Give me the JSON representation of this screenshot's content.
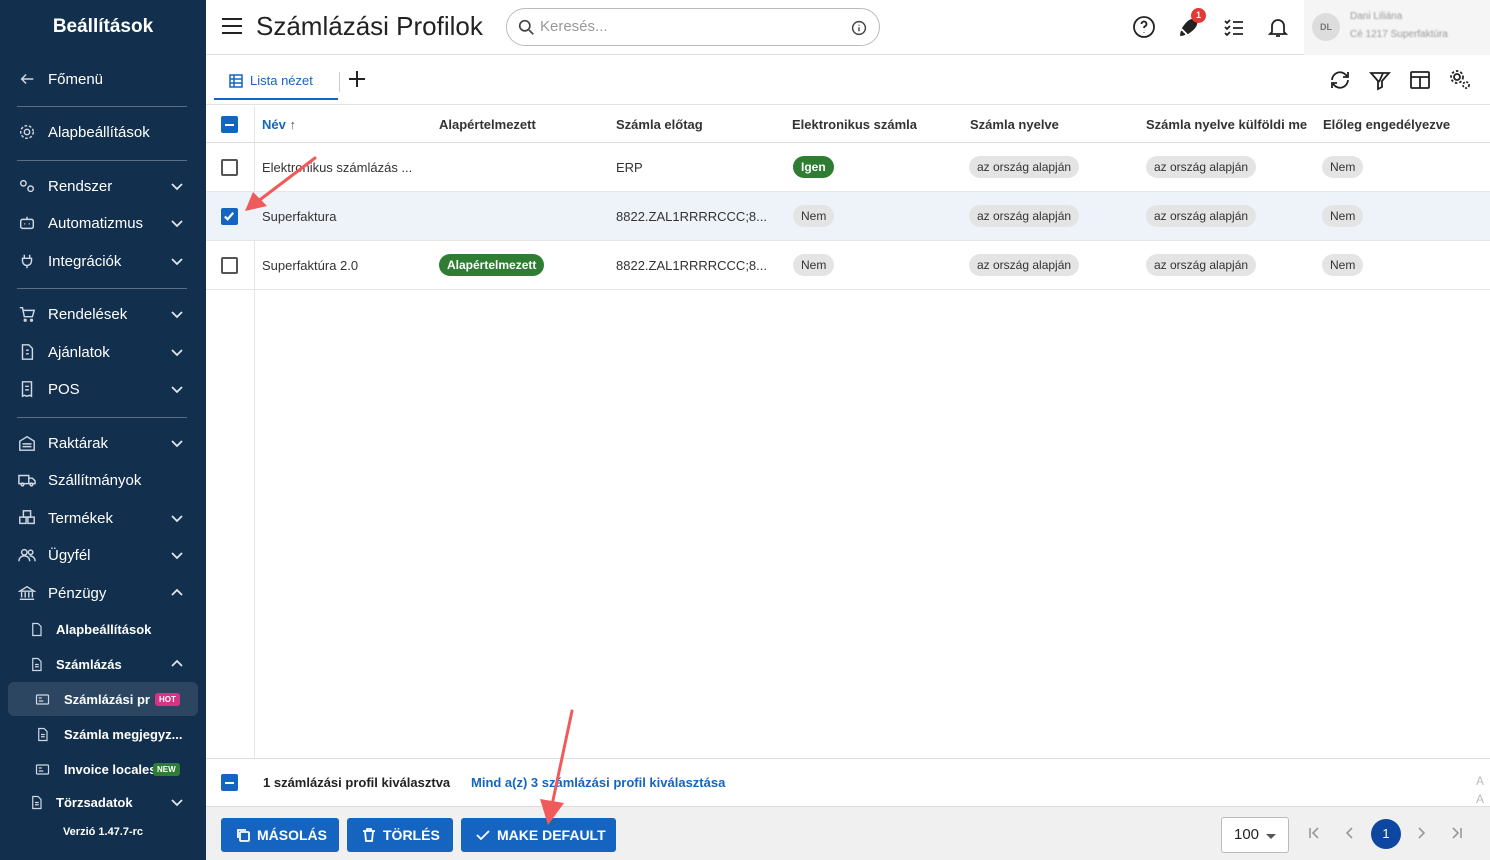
{
  "sidebar": {
    "title": "Beállítások",
    "items": [
      {
        "label": "Főmenü",
        "icon": "arrow-left-icon"
      },
      {
        "label": "Alapbeállítások",
        "icon": "gear-icon"
      },
      {
        "label": "Rendszer",
        "icon": "settings-icon"
      },
      {
        "label": "Automatizmus",
        "icon": "robot-icon"
      },
      {
        "label": "Integrációk",
        "icon": "plug-icon"
      },
      {
        "label": "Rendelések",
        "icon": "cart-icon"
      },
      {
        "label": "Ajánlatok",
        "icon": "document-icon"
      },
      {
        "label": "POS",
        "icon": "receipt-icon"
      },
      {
        "label": "Raktárak",
        "icon": "warehouse-icon"
      },
      {
        "label": "Szállítmányok",
        "icon": "truck-icon"
      },
      {
        "label": "Termékek",
        "icon": "box-icon"
      },
      {
        "label": "Ügyfél",
        "icon": "users-icon"
      },
      {
        "label": "Pénzügy",
        "icon": "bank-icon"
      }
    ],
    "sub": [
      {
        "label": "Alapbeállítások"
      },
      {
        "label": "Számlázás"
      },
      {
        "label": "Számlázási pr",
        "badge": "HOT"
      },
      {
        "label": "Számla megjegyz..."
      },
      {
        "label": "Invoice locales",
        "badge": "NEW"
      },
      {
        "label": "Törzsadatok"
      }
    ],
    "version": "Verzió 1.47.7-rc"
  },
  "header": {
    "title": "Számlázási Profilok",
    "search_placeholder": "Keresés...",
    "notification_count": "1",
    "user_name": "Dani Liliána",
    "user_company": "Cé 1217 Superfaktúra",
    "avatar_initials": "DL"
  },
  "toolbar": {
    "tab_label": "Lista nézet"
  },
  "table": {
    "columns": [
      "Név",
      "Alapértelmezett",
      "Számla előtag",
      "Elektronikus számla",
      "Számla nyelve",
      "Számla nyelve külföldi me",
      "Előleg engedélyezve"
    ],
    "rows": [
      {
        "name": "Elektronikus számlázás ...",
        "default": "",
        "prefix": "ERP",
        "einvoice": "Igen",
        "lang": "az ország alapján",
        "lang_foreign": "az ország alapján",
        "deposit": "Nem"
      },
      {
        "name": "Superfaktura",
        "default": "",
        "prefix": "8822.ZAL1RRRRCCC;8...",
        "einvoice": "Nem",
        "lang": "az ország alapján",
        "lang_foreign": "az ország alapján",
        "deposit": "Nem"
      },
      {
        "name": "Superfaktúra 2.0",
        "default": "Alapértelmezett",
        "prefix": "8822.ZAL1RRRRCCC;8...",
        "einvoice": "Nem",
        "lang": "az ország alapján",
        "lang_foreign": "az ország alapján",
        "deposit": "Nem"
      }
    ],
    "selected_row": 1,
    "selection_text": "1 számlázási profil kiválasztva",
    "select_all_text": "Mind a(z) 3 számlázási profil kiválasztása"
  },
  "actions": {
    "copy": "MÁSOLÁS",
    "delete": "TÖRLÉS",
    "make_default": "MAKE DEFAULT"
  },
  "pagination": {
    "page_size": "100",
    "current_page": "1"
  },
  "colors": {
    "sidebar_bg": "#12304d",
    "primary": "#1565c0",
    "success": "#2e7d32",
    "annotation_arrow": "#f05a5a"
  }
}
